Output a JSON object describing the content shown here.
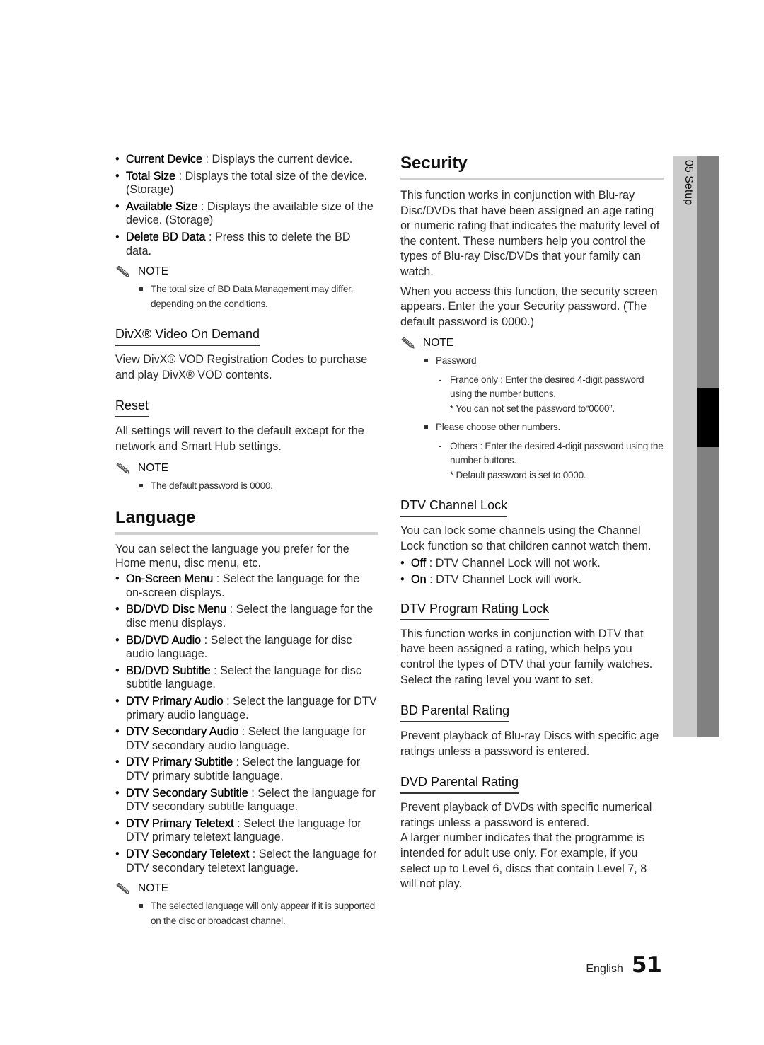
{
  "left_column": {
    "intro_bullets": [
      {
        "term": "Current Device",
        "desc": " : Displays the current device."
      },
      {
        "term": "Total Size",
        "desc": " : Displays the total size of the device. (Storage)"
      },
      {
        "term": "Available Size",
        "desc": " : Displays the available size of the device. (Storage)"
      },
      {
        "term": "Delete BD Data",
        "desc": " : Press this to delete the BD data."
      }
    ],
    "note1": {
      "label": "NOTE",
      "items": [
        "The total size of BD Data Management may differ, depending on the conditions."
      ]
    },
    "divx": {
      "heading": "DivX® Video On Demand",
      "text": "View DivX® VOD Registration Codes to purchase and play DivX® VOD contents."
    },
    "reset": {
      "heading": "Reset",
      "text": "All settings will revert to the default except for the network and Smart Hub settings.",
      "note": {
        "label": "NOTE",
        "items": [
          "The default password is 0000."
        ]
      }
    },
    "language": {
      "title": "Language",
      "intro": "You can select the language you prefer for the Home menu, disc menu, etc.",
      "bullets": [
        {
          "term": "On-Screen Menu",
          "desc": " : Select the language for the on-screen displays."
        },
        {
          "term": "BD/DVD Disc Menu",
          "desc": " : Select the language for the disc menu displays."
        },
        {
          "term": "BD/DVD Audio",
          "desc": " : Select the language for disc audio language."
        },
        {
          "term": "BD/DVD Subtitle",
          "desc": " : Select the language for disc subtitle language."
        },
        {
          "term": "DTV Primary Audio",
          "desc": " : Select the language for DTV primary audio language."
        },
        {
          "term": "DTV Secondary Audio",
          "desc": " : Select the language for DTV secondary audio language."
        },
        {
          "term": "DTV Primary Subtitle",
          "desc": " : Select the language for DTV primary subtitle language."
        },
        {
          "term": "DTV Secondary Subtitle",
          "desc": " : Select the language for DTV secondary subtitle language."
        },
        {
          "term": "DTV Primary Teletext",
          "desc": " : Select the language for DTV primary teletext language."
        },
        {
          "term": "DTV Secondary Teletext",
          "desc": " : Select the language for DTV secondary teletext language."
        }
      ],
      "note": {
        "label": "NOTE",
        "items": [
          "The selected language will only appear if it is supported on the disc or broadcast channel."
        ]
      }
    }
  },
  "right_column": {
    "security": {
      "title": "Security",
      "para1": "This function works in conjunction with Blu-ray Disc/DVDs that have been assigned an age rating or numeric rating that indicates the maturity level of the content. These numbers help you control the types of Blu-ray Disc/DVDs that your family can watch.",
      "para2": "When you access this function, the security screen appears. Enter the your Security password. (The default password is 0000.)",
      "note": {
        "label": "NOTE",
        "item1": "Password",
        "item1_dash": "France only : Enter the desired 4-digit password using the number buttons.",
        "item1_star": "* You can not set the password to“0000”.",
        "item2": "Please choose other numbers.",
        "item2_dash": "Others : Enter the desired 4-digit password using the number buttons.",
        "item2_star": "* Default password is set to 0000."
      }
    },
    "dtv_channel_lock": {
      "heading": "DTV Channel Lock",
      "text": "You can lock some channels using the Channel Lock function so that children cannot watch them.",
      "bullets": [
        {
          "term": "Off",
          "desc": " : DTV Channel Lock will not work."
        },
        {
          "term": "On",
          "desc": " : DTV Channel Lock will work."
        }
      ]
    },
    "dtv_program_rating_lock": {
      "heading": "DTV Program Rating Lock",
      "text": "This function works in conjunction with DTV that have been assigned a rating, which helps you control the types of DTV that your family watches. Select the rating level you want to set."
    },
    "bd_parental_rating": {
      "heading": "BD Parental Rating",
      "text": "Prevent playback of Blu-ray Discs with specific age ratings unless a password is entered."
    },
    "dvd_parental_rating": {
      "heading": "DVD Parental Rating",
      "text1": "Prevent playback of DVDs with specific numerical ratings unless a password is entered.",
      "text2": "A larger number indicates that the programme is intended for adult use only. For example, if you select up to Level 6, discs that contain Level 7, 8 will not play."
    }
  },
  "side_tab": {
    "chapter": "05  Setup"
  },
  "footer": {
    "language": "English",
    "page_number": "51"
  },
  "colors": {
    "tab_light": "#cbcbcb",
    "tab_dark": "#808080",
    "tab_active": "#000000",
    "title_rule": "#cfcfcf"
  }
}
